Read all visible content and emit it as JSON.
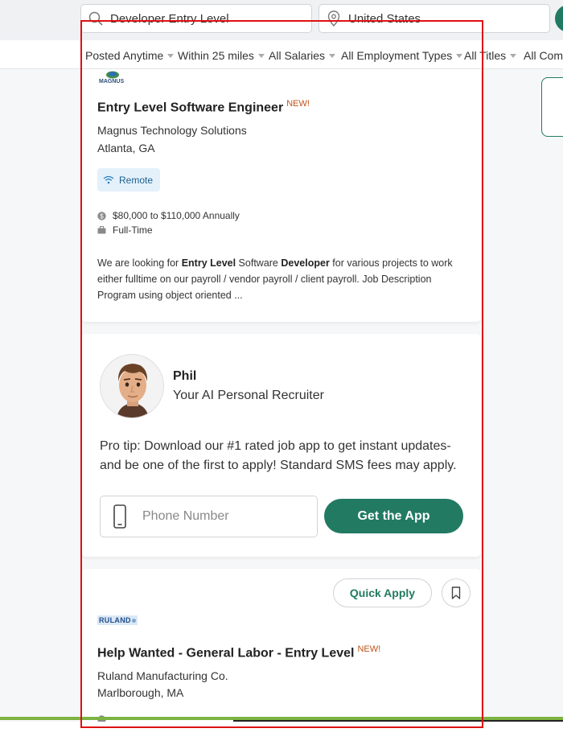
{
  "search": {
    "keyword_value": "Developer Entry Level",
    "location_value": "United States"
  },
  "filters": [
    {
      "label": "Posted Anytime"
    },
    {
      "label": "Within 25 miles"
    },
    {
      "label": "All Salaries"
    },
    {
      "label": "All Employment Types"
    },
    {
      "label": "All Titles"
    },
    {
      "label": "All Comp"
    }
  ],
  "jobs": [
    {
      "logo_text": "MAGNUS",
      "title": "Entry Level Software Engineer",
      "badge": "NEW!",
      "company": "Magnus Technology Solutions",
      "location": "Atlanta, GA",
      "remote_label": "Remote",
      "salary": "$80,000 to $110,000 Annually",
      "employment_type": "Full-Time",
      "description_parts": [
        "We are looking for ",
        "Entry Level",
        " Software ",
        "Developer",
        " for various projects to work either fulltime on our payroll / vendor payroll / client payroll. Job Description Program using object oriented ..."
      ]
    },
    {
      "logo_text": "RULAND",
      "title": "Help Wanted - General Labor - Entry Level",
      "badge": "NEW!",
      "company": "Ruland Manufacturing Co.",
      "location": "Marlborough, MA",
      "quick_apply_label": "Quick Apply"
    }
  ],
  "recruiter": {
    "name": "Phil",
    "role": "Your AI Personal Recruiter",
    "tip": "Pro tip: Download our #1 rated job app to get instant updates- and be one of the first to apply! Standard SMS fees may apply.",
    "phone_placeholder": "Phone Number",
    "cta_label": "Get the App"
  },
  "colors": {
    "brand_green": "#227a62",
    "new_badge": "#c0531a",
    "remote_pill_bg": "#e4f1fb",
    "highlight_frame": "#e01010"
  }
}
